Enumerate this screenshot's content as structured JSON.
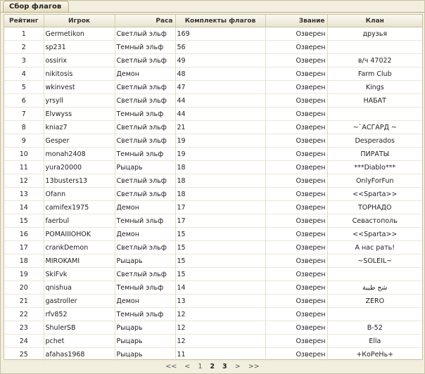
{
  "tab_label": "Сбор флагов",
  "columns": [
    "Рейтинг",
    "Игрок",
    "Раса",
    "Комплекты флагов",
    "Звание",
    "Клан"
  ],
  "rows": [
    {
      "rank": "1",
      "player": "Germetikon",
      "race": "Светлый эльф",
      "flags": "169",
      "title": "Озверен",
      "clan": "друзья"
    },
    {
      "rank": "2",
      "player": "sp231",
      "race": "Темный эльф",
      "flags": "56",
      "title": "Озверен",
      "clan": ""
    },
    {
      "rank": "3",
      "player": "ossirix",
      "race": "Светлый эльф",
      "flags": "49",
      "title": "Озверен",
      "clan": "в/ч 47022"
    },
    {
      "rank": "4",
      "player": "nikitosis",
      "race": "Демон",
      "flags": "48",
      "title": "Озверен",
      "clan": "Farm Club"
    },
    {
      "rank": "5",
      "player": "wkinvest",
      "race": "Светлый эльф",
      "flags": "47",
      "title": "Озверен",
      "clan": "Kings"
    },
    {
      "rank": "6",
      "player": "yrsyll",
      "race": "Светлый эльф",
      "flags": "44",
      "title": "Озверен",
      "clan": "НАБАТ"
    },
    {
      "rank": "7",
      "player": "Elvwyss",
      "race": "Темный эльф",
      "flags": "44",
      "title": "Озверен",
      "clan": ""
    },
    {
      "rank": "8",
      "player": "kniaz7",
      "race": "Светлый эльф",
      "flags": "21",
      "title": "Озверен",
      "clan": "~`АСГАРД ~"
    },
    {
      "rank": "9",
      "player": "Gesper",
      "race": "Светлый эльф",
      "flags": "19",
      "title": "Озверен",
      "clan": "Desperados"
    },
    {
      "rank": "10",
      "player": "monah2408",
      "race": "Темный эльф",
      "flags": "19",
      "title": "Озверен",
      "clan": "ПИРАТЫ"
    },
    {
      "rank": "11",
      "player": "yura20000",
      "race": "Рыцарь",
      "flags": "18",
      "title": "Озверен",
      "clan": "***Diablo***"
    },
    {
      "rank": "12",
      "player": "13busters13",
      "race": "Светлый эльф",
      "flags": "18",
      "title": "Озверен",
      "clan": "OnlyForFun"
    },
    {
      "rank": "13",
      "player": "Ofann",
      "race": "Светлый эльф",
      "flags": "18",
      "title": "Озверен",
      "clan": "<<Sparta>>"
    },
    {
      "rank": "14",
      "player": "camifex1975",
      "race": "Демон",
      "flags": "17",
      "title": "Озверен",
      "clan": "ТОРНАДО"
    },
    {
      "rank": "15",
      "player": "faerbul",
      "race": "Темный эльф",
      "flags": "17",
      "title": "Озверен",
      "clan": "Севастополь"
    },
    {
      "rank": "16",
      "player": "POMAIIIOHOK",
      "race": "Демон",
      "flags": "15",
      "title": "Озверен",
      "clan": "<<Sparta>>"
    },
    {
      "rank": "17",
      "player": "crankDemon",
      "race": "Светлый эльф",
      "flags": "15",
      "title": "Озверен",
      "clan": "А нас рать!"
    },
    {
      "rank": "18",
      "player": "MIROKAMI",
      "race": "Рыцарь",
      "flags": "15",
      "title": "Озверен",
      "clan": "~SOLEIL~"
    },
    {
      "rank": "19",
      "player": "SkiFvk",
      "race": "Светлый эльф",
      "flags": "15",
      "title": "Озверен",
      "clan": ""
    },
    {
      "rank": "20",
      "player": "qnishua",
      "race": "Темный эльф",
      "flags": "14",
      "title": "Озверен",
      "clan": "شح طيبة"
    },
    {
      "rank": "21",
      "player": "gastroller",
      "race": "Демон",
      "flags": "13",
      "title": "Озверен",
      "clan": "ZERO"
    },
    {
      "rank": "22",
      "player": "rfv852",
      "race": "Темный эльф",
      "flags": "12",
      "title": "Озверен",
      "clan": ""
    },
    {
      "rank": "23",
      "player": "ShulerSB",
      "race": "Рыцарь",
      "flags": "12",
      "title": "Озверен",
      "clan": "B-52"
    },
    {
      "rank": "24",
      "player": "pchet",
      "race": "Рыцарь",
      "flags": "12",
      "title": "Озверен",
      "clan": "Ella"
    },
    {
      "rank": "25",
      "player": "afahas1968",
      "race": "Рыцарь",
      "flags": "11",
      "title": "Озверен",
      "clan": "+КоРеНь+"
    }
  ],
  "pager": {
    "first": "<<",
    "prev": "<",
    "pages": [
      "1",
      "2",
      "3"
    ],
    "current": "2",
    "next": ">",
    "last": ">>"
  }
}
